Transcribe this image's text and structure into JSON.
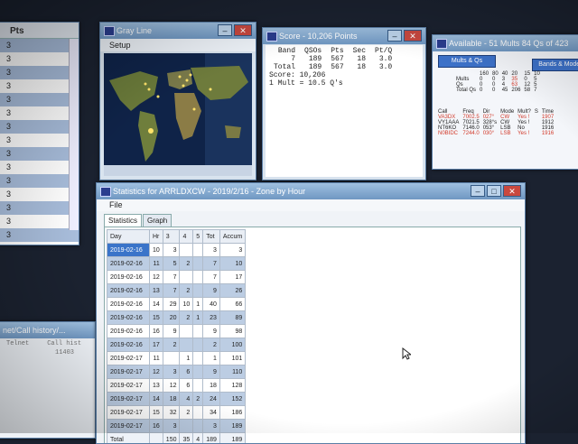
{
  "left_list": {
    "header": "Pts",
    "rows": [
      "3",
      "3",
      "3",
      "3",
      "3",
      "3",
      "3",
      "3",
      "3",
      "3",
      "3",
      "3",
      "3",
      "3",
      "3"
    ]
  },
  "gray_line": {
    "title": "Gray Line",
    "menu": "Setup"
  },
  "score": {
    "title": "Score - 10,206 Points",
    "headers": [
      "Band",
      "QSOs",
      "Pts",
      "Sec",
      "Pt/Q"
    ],
    "rows": [
      [
        "7",
        "189",
        "567",
        "18",
        "3.0"
      ],
      [
        "Total",
        "189",
        "567",
        "18",
        "3.0"
      ]
    ],
    "score_line": "Score: 10,206",
    "mult_line": "1 Mult = 10.5 Q's"
  },
  "available": {
    "title": "Available - 51 Mults 84 Qs of 423",
    "button_left": "Mults & Qs",
    "button_right": "Bands & Modes",
    "bands": [
      "160",
      "80",
      "40",
      "20",
      "15",
      "10"
    ],
    "rows": [
      {
        "label": "Mults",
        "values": [
          "0",
          "0",
          "3",
          "35",
          "0",
          "5"
        ]
      },
      {
        "label": "Qs",
        "values": [
          "0",
          "0",
          "4",
          "63",
          "12",
          "5"
        ]
      },
      {
        "label": "Total Qs",
        "values": [
          "0",
          "0",
          "45",
          "206",
          "58",
          "7"
        ]
      }
    ],
    "spots_headers": [
      "Call",
      "Freq",
      "Dir",
      "Mode",
      "Mult?",
      "S",
      "Time"
    ],
    "spots": [
      {
        "call": "VA3DX",
        "freq": "7002.5",
        "dir": "027°",
        "mode": "CW",
        "mult": "Yes !",
        "time": "1907"
      },
      {
        "call": "VY1AAA",
        "freq": "7021.5",
        "dir": "328°s",
        "mode": "CW",
        "mult": "Yes !",
        "time": "1912"
      },
      {
        "call": "NT6KO",
        "freq": "7146.0",
        "dir": "053°",
        "mode": "LSB",
        "mult": "No",
        "time": "1916"
      },
      {
        "call": "N0BIDC",
        "freq": "7244.0",
        "dir": "030°",
        "mode": "LSB",
        "mult": "Yes !",
        "time": "1916"
      }
    ]
  },
  "bottom_left": {
    "title": "net/Call history/...",
    "col1": "Telnet",
    "col2": "Call hist",
    "val": "11403"
  },
  "stats": {
    "title": "Statistics for ARRLDXCW - 2019/2/16 - Zone by Hour",
    "menu": "File",
    "tabs": [
      "Statistics",
      "Graph"
    ],
    "headers": [
      "Day",
      "Hr",
      "3",
      "4",
      "5",
      "Tot",
      "Accum"
    ],
    "rows": [
      [
        "2019-02-16",
        "10",
        "3",
        "",
        "",
        "3",
        "3"
      ],
      [
        "2019-02-16",
        "11",
        "5",
        "2",
        "",
        "7",
        "10"
      ],
      [
        "2019-02-16",
        "12",
        "7",
        "",
        "",
        "7",
        "17"
      ],
      [
        "2019-02-16",
        "13",
        "7",
        "2",
        "",
        "9",
        "26"
      ],
      [
        "2019-02-16",
        "14",
        "29",
        "10",
        "1",
        "40",
        "66"
      ],
      [
        "2019-02-16",
        "15",
        "20",
        "2",
        "1",
        "23",
        "89"
      ],
      [
        "2019-02-16",
        "16",
        "9",
        "",
        "",
        "9",
        "98"
      ],
      [
        "2019-02-16",
        "17",
        "2",
        "",
        "",
        "2",
        "100"
      ],
      [
        "2019-02-17",
        "11",
        "",
        "1",
        "",
        "1",
        "101"
      ],
      [
        "2019-02-17",
        "12",
        "3",
        "6",
        "",
        "9",
        "110"
      ],
      [
        "2019-02-17",
        "13",
        "12",
        "6",
        "",
        "18",
        "128"
      ],
      [
        "2019-02-17",
        "14",
        "18",
        "4",
        "2",
        "24",
        "152"
      ],
      [
        "2019-02-17",
        "15",
        "32",
        "2",
        "",
        "34",
        "186"
      ],
      [
        "2019-02-17",
        "16",
        "3",
        "",
        "",
        "3",
        "189"
      ]
    ],
    "total": [
      "Total",
      "",
      "150",
      "35",
      "4",
      "189",
      "189"
    ]
  }
}
